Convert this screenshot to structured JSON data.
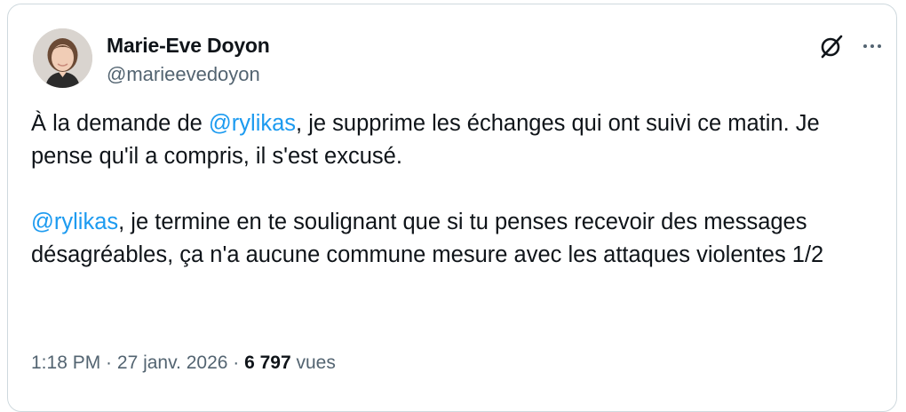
{
  "author": {
    "name": "Marie-Eve Doyon",
    "handle": "@marieevedoyon"
  },
  "header_icons": [
    "grok-icon",
    "more-options-icon"
  ],
  "tweet": {
    "p1": {
      "pre": "À la demande de ",
      "mention": "@rylikas",
      "post": ", je supprime les échanges qui ont suivi ce matin. Je pense qu'il a compris, il s'est excusé."
    },
    "p2": {
      "mention": "@rylikas",
      "post": ", je termine en te soulignant que si tu penses recevoir des messages désagréables, ça n'a aucune commune mesure avec les attaques violentes  1/2"
    }
  },
  "meta": {
    "time": "1:18 PM",
    "separator": " · ",
    "date": "27 janv. 2026",
    "views_count": "6 797",
    "views_label": " vues"
  },
  "colors": {
    "mention": "#1d9bf0",
    "text": "#0f1419",
    "secondary": "#536471",
    "border": "#cfd9de"
  }
}
